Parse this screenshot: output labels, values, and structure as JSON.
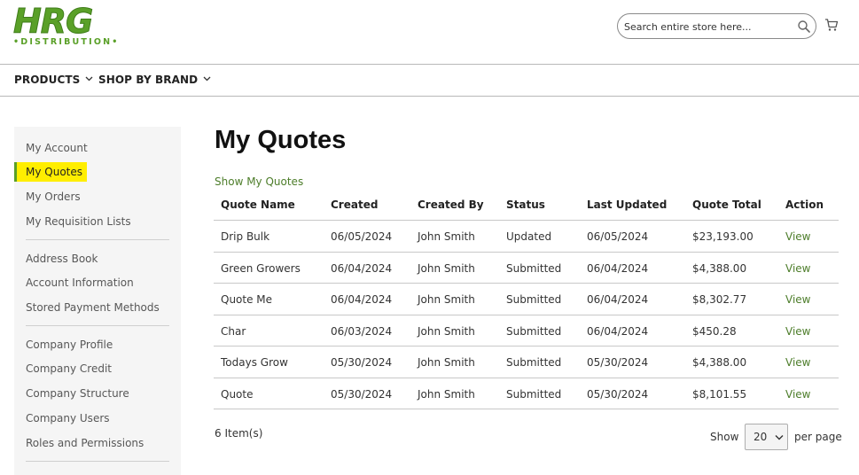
{
  "brand": {
    "logo_main": "HRG",
    "logo_sub": "•DISTRIBUTION•",
    "accent": "#5aa028"
  },
  "header": {
    "search_placeholder": "Search entire store here...",
    "search_icon": "search-icon",
    "cart_icon": "cart-icon"
  },
  "nav": {
    "items": [
      {
        "label": "PRODUCTS"
      },
      {
        "label": "SHOP BY BRAND"
      }
    ]
  },
  "sidebar": {
    "groups": [
      [
        "My Account",
        "My Quotes",
        "My Orders",
        "My Requisition Lists"
      ],
      [
        "Address Book",
        "Account Information",
        "Stored Payment Methods"
      ],
      [
        "Company Profile",
        "Company Credit",
        "Company Structure",
        "Company Users",
        "Roles and Permissions"
      ]
    ],
    "active": "My Quotes",
    "highlight_color": "#ffee00"
  },
  "main": {
    "title": "My Quotes",
    "show_link": "Show My Quotes",
    "table": {
      "headers": [
        "Quote Name",
        "Created",
        "Created By",
        "Status",
        "Last Updated",
        "Quote Total",
        "Action"
      ],
      "rows": [
        [
          "Drip Bulk",
          "06/05/2024",
          "John Smith",
          "Updated",
          "06/05/2024",
          "$23,193.00",
          "View"
        ],
        [
          "Green Growers",
          "06/04/2024",
          "John Smith",
          "Submitted",
          "06/04/2024",
          "$4,388.00",
          "View"
        ],
        [
          "Quote Me",
          "06/04/2024",
          "John Smith",
          "Submitted",
          "06/04/2024",
          "$8,302.77",
          "View"
        ],
        [
          "Char",
          "06/03/2024",
          "John Smith",
          "Submitted",
          "06/04/2024",
          "$450.28",
          "View"
        ],
        [
          "Todays Grow",
          "05/30/2024",
          "John Smith",
          "Submitted",
          "05/30/2024",
          "$4,388.00",
          "View"
        ],
        [
          "Quote",
          "05/30/2024",
          "John Smith",
          "Submitted",
          "05/30/2024",
          "$8,101.55",
          "View"
        ]
      ]
    },
    "items_count": "6 Item(s)",
    "pager": {
      "show_label": "Show",
      "limit": "20",
      "per_page_label": "per page"
    }
  }
}
